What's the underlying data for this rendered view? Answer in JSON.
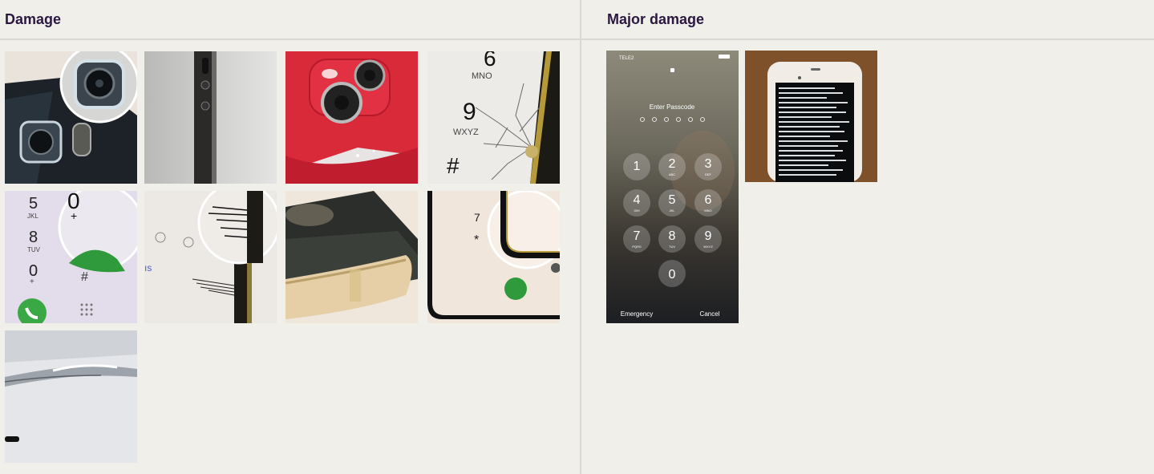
{
  "sections": [
    {
      "title": "Damage"
    },
    {
      "title": "Major damage"
    }
  ],
  "lockscreen": {
    "carrier": "TELE2",
    "prompt": "Enter Passcode",
    "keys": [
      {
        "num": "1",
        "letters": ""
      },
      {
        "num": "2",
        "letters": "ABC"
      },
      {
        "num": "3",
        "letters": "DEF"
      },
      {
        "num": "4",
        "letters": "GHI"
      },
      {
        "num": "5",
        "letters": "JKL"
      },
      {
        "num": "6",
        "letters": "MNO"
      },
      {
        "num": "7",
        "letters": "PQRS"
      },
      {
        "num": "8",
        "letters": "TUV"
      },
      {
        "num": "9",
        "letters": "WXYZ"
      },
      {
        "num": "0",
        "letters": ""
      }
    ],
    "emergency": "Emergency",
    "cancel": "Cancel"
  },
  "thumb_text": {
    "crack_six": "6",
    "crack_mno": "MNO",
    "crack_nine": "9",
    "crack_wxyz": "WXYZ",
    "crack_hash": "#",
    "pad_five": "5",
    "pad_jkl": "JKL",
    "pad_eight": "8",
    "pad_tuv": "TUV",
    "pad_zero": "0",
    "pad_plus": "+",
    "pad_hash": "#",
    "pad_big_zero": "0",
    "pad_big_plus": "+",
    "lines_text": "ıs",
    "edge_seven": "7",
    "edge_star": "*"
  }
}
